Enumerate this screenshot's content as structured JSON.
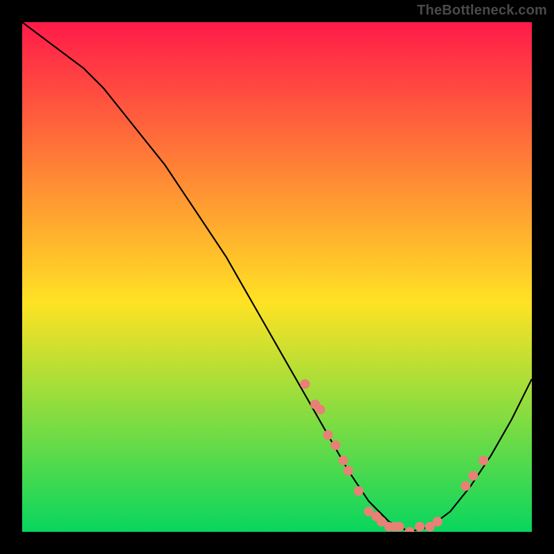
{
  "attribution": "TheBottleneck.com",
  "chart_data": {
    "type": "line",
    "title": "",
    "xlabel": "",
    "ylabel": "",
    "xlim": [
      0,
      100
    ],
    "ylim": [
      0,
      100
    ],
    "grid": false,
    "legend": false,
    "background_gradient": {
      "top": "#ff1a49",
      "mid": "#ffe224",
      "bottom": "#08d65e"
    },
    "series": [
      {
        "name": "bottleneck-curve",
        "color": "#000000",
        "x": [
          0,
          4,
          8,
          12,
          16,
          20,
          24,
          28,
          32,
          36,
          40,
          44,
          48,
          52,
          56,
          60,
          64,
          68,
          72,
          76,
          80,
          84,
          88,
          92,
          96,
          100
        ],
        "y": [
          100,
          97,
          94,
          91,
          87,
          82,
          77,
          72,
          66,
          60,
          54,
          47,
          40,
          33,
          26,
          19,
          12,
          6,
          2,
          0,
          1,
          4,
          9,
          15,
          22,
          30
        ]
      }
    ],
    "markers": {
      "name": "highlight-points",
      "color": "#e98076",
      "radius_px": 7,
      "points": [
        {
          "x": 55.5,
          "y": 29
        },
        {
          "x": 57.5,
          "y": 25
        },
        {
          "x": 58.5,
          "y": 24
        },
        {
          "x": 60.0,
          "y": 19
        },
        {
          "x": 61.5,
          "y": 17
        },
        {
          "x": 63.0,
          "y": 14
        },
        {
          "x": 64.0,
          "y": 12
        },
        {
          "x": 66.0,
          "y": 8
        },
        {
          "x": 68.0,
          "y": 4
        },
        {
          "x": 69.5,
          "y": 3
        },
        {
          "x": 70.5,
          "y": 2
        },
        {
          "x": 72.0,
          "y": 1
        },
        {
          "x": 73.0,
          "y": 1
        },
        {
          "x": 74.0,
          "y": 1
        },
        {
          "x": 76.0,
          "y": 0
        },
        {
          "x": 78.0,
          "y": 1
        },
        {
          "x": 80.0,
          "y": 1
        },
        {
          "x": 81.5,
          "y": 2
        },
        {
          "x": 87.0,
          "y": 9
        },
        {
          "x": 88.5,
          "y": 11
        },
        {
          "x": 90.5,
          "y": 14
        }
      ]
    }
  }
}
